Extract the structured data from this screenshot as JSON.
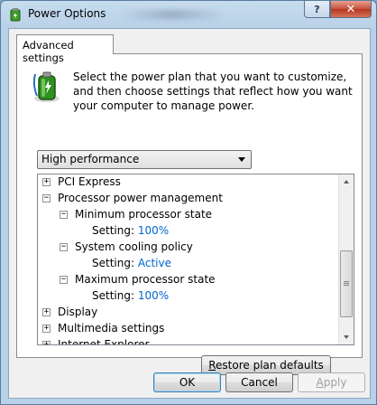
{
  "window": {
    "title": "Power Options",
    "help_label": "?",
    "close_label": "✕"
  },
  "tab": {
    "label": "Advanced settings"
  },
  "description": "Select the power plan that you want to customize, and then choose settings that reflect how you want your computer to manage power.",
  "plan_select": {
    "selected": "High performance"
  },
  "tree": {
    "items": [
      {
        "label": "PCI Express",
        "expander": "+"
      },
      {
        "label": "Processor power management",
        "expander": "−"
      },
      {
        "label": "Minimum processor state",
        "expander": "−"
      },
      {
        "label": "Setting:",
        "value": "100%"
      },
      {
        "label": "System cooling policy",
        "expander": "−"
      },
      {
        "label": "Setting:",
        "value": "Active"
      },
      {
        "label": "Maximum processor state",
        "expander": "−"
      },
      {
        "label": "Setting:",
        "value": "100%"
      },
      {
        "label": "Display",
        "expander": "+"
      },
      {
        "label": "Multimedia settings",
        "expander": "+"
      },
      {
        "label": "Internet Explorer",
        "expander": "+"
      }
    ]
  },
  "buttons": {
    "restore": {
      "mnemonic": "R",
      "rest": "estore plan defaults"
    },
    "ok": "OK",
    "cancel": "Cancel",
    "apply": {
      "mnemonic": "A",
      "rest": "pply"
    }
  },
  "icons": [
    "power-options-icon",
    "battery-icon",
    "expand-icon",
    "collapse-icon",
    "dropdown-arrow-icon",
    "scroll-up-icon",
    "scroll-down-icon"
  ]
}
